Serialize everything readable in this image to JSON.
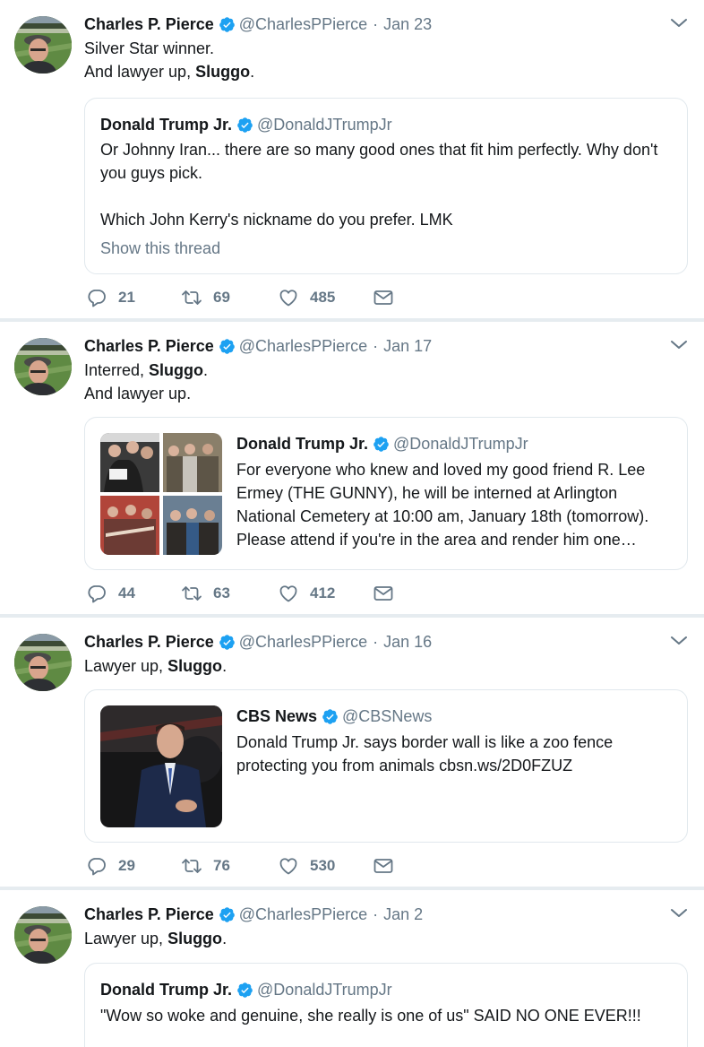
{
  "tweets": [
    {
      "name": "Charles P. Pierce",
      "handle": "@CharlesPPierce",
      "dot": "·",
      "time": "Jan 23",
      "line1_prefix": "Silver Star winner.",
      "line2_prefix": "And lawyer up, ",
      "line2_bold": "Sluggo",
      "line2_suffix": ".",
      "quote": {
        "name": "Donald Trump Jr.",
        "handle": "@DonaldJTrumpJr",
        "text1": "Or Johnny Iran... there are so many good ones that fit him perfectly. Why don't you guys pick.",
        "text2": "Which John Kerry's nickname do you prefer. LMK",
        "show_thread": "Show this thread"
      },
      "replies": "21",
      "retweets": "69",
      "likes": "485"
    },
    {
      "name": "Charles P. Pierce",
      "handle": "@CharlesPPierce",
      "dot": "·",
      "time": "Jan 17",
      "line1_prefix": "Interred, ",
      "line1_bold": "Sluggo",
      "line1_suffix": ".",
      "line2_prefix": "And lawyer up.",
      "quote": {
        "name": "Donald Trump Jr.",
        "handle": "@DonaldJTrumpJr",
        "text1": "For everyone who knew and loved my good friend R. Lee Ermey (THE GUNNY), he will be interned at Arlington National Cemetery at 10:00 am, January 18th (tomorrow). Please attend if you're in the area and render him one…"
      },
      "replies": "44",
      "retweets": "63",
      "likes": "412"
    },
    {
      "name": "Charles P. Pierce",
      "handle": "@CharlesPPierce",
      "dot": "·",
      "time": "Jan 16",
      "line1_prefix": "Lawyer up, ",
      "line1_bold": "Sluggo",
      "line1_suffix": ".",
      "quote": {
        "name": "CBS News",
        "handle": "@CBSNews",
        "text1": "Donald Trump Jr. says border wall is like a zoo fence protecting you from animals cbsn.ws/2D0FZUZ"
      },
      "replies": "29",
      "retweets": "76",
      "likes": "530"
    },
    {
      "name": "Charles P. Pierce",
      "handle": "@CharlesPPierce",
      "dot": "·",
      "time": "Jan 2",
      "line1_prefix": "Lawyer up, ",
      "line1_bold": "Sluggo",
      "line1_suffix": ".",
      "quote": {
        "name": "Donald Trump Jr.",
        "handle": "@DonaldJTrumpJr",
        "text1": "\"Wow so woke and genuine, she really is one of us\" SAID NO ONE EVER!!!"
      }
    }
  ],
  "icons": {
    "verified": "verified-badge-icon",
    "caret": "chevron-down-icon",
    "reply": "reply-icon",
    "retweet": "retweet-icon",
    "like": "heart-icon",
    "message": "direct-message-icon"
  },
  "colors": {
    "verified": "#1da1f2",
    "secondary_text": "#657786",
    "divider": "#e6ecf0",
    "border": "#e1e8ed"
  }
}
